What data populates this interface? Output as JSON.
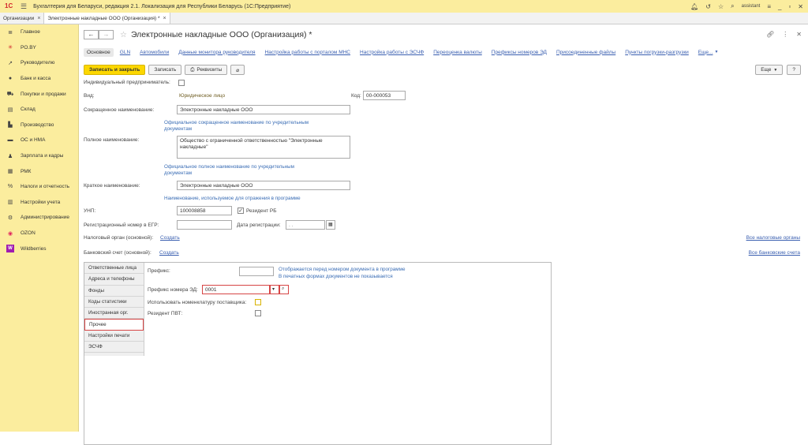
{
  "app": {
    "title": "Бухгалтерия для Беларуси, редакция 2.1. Локализация для Республики Беларусь (1С:Предприятие)",
    "logo": "1С",
    "user": "assistant"
  },
  "window_tabs": [
    {
      "label": "Организации"
    },
    {
      "label": "Электронные накладные ООО (Организация) *"
    }
  ],
  "sidebar": {
    "items": [
      {
        "label": "Главное",
        "icon": "menu-icon"
      },
      {
        "label": "PO.BY",
        "icon": "snowflake-icon"
      },
      {
        "label": "Руководителю",
        "icon": "chart-icon"
      },
      {
        "label": "Банк и касса",
        "icon": "coin-icon"
      },
      {
        "label": "Покупки и продажи",
        "icon": "cart-icon"
      },
      {
        "label": "Склад",
        "icon": "box-icon"
      },
      {
        "label": "Производство",
        "icon": "factory-icon"
      },
      {
        "label": "ОС и НМА",
        "icon": "truck-icon"
      },
      {
        "label": "Зарплата и кадры",
        "icon": "person-icon"
      },
      {
        "label": "РМК",
        "icon": "register-icon"
      },
      {
        "label": "Налоги и отчетность",
        "icon": "percent-icon"
      },
      {
        "label": "Настройки учета",
        "icon": "book-icon"
      },
      {
        "label": "Администрирование",
        "icon": "gear-icon"
      },
      {
        "label": "OZON",
        "icon": "ozon-icon"
      },
      {
        "label": "Wildberries",
        "icon": "wildberries-icon"
      }
    ]
  },
  "form": {
    "title": "Электронные накладные ООО (Организация) *",
    "links": [
      "Основное",
      "GLN",
      "Автомобили",
      "Данные монитора руководителя",
      "Настройка работы с порталом МНС",
      "Настройка работы с ЭСЧФ",
      "Переоценка валюты",
      "Префиксы номеров ЭД",
      "Присоединенные файлы",
      "Пункты погрузки-разгрузки",
      "Еще..."
    ],
    "toolbar": {
      "save_close": "Записать и закрыть",
      "save": "Записать",
      "requisites": "Реквизиты",
      "more": "Еще",
      "help": "?"
    },
    "individual_label": "Индивидуальный предприниматель:",
    "kind_label": "Вид:",
    "kind_value": "Юридическое лицо",
    "code_label": "Код:",
    "code_value": "00-000053",
    "short_name_label": "Сокращенное наименование:",
    "short_name_value": "Электронные накладные ООО",
    "short_name_hint": "Официальное сокращенное наименование по учредительным документам",
    "full_name_label": "Полное наименование:",
    "full_name_value": "Общество с ограниченной ответственностью \"Электронные накладные\"",
    "full_name_hint": "Официальное полное наименование по учредительным документам",
    "brief_name_label": "Краткое наименование:",
    "brief_name_value": "Электронные накладные ООО",
    "brief_name_hint": "Наименование, используемое для отражения в программе",
    "unp_label": "УНП:",
    "unp_value": "100008858",
    "resident_label": "Резидент РБ",
    "egr_label": "Регистрационный номер в ЕГР:",
    "reg_date_label": "Дата регистрации:",
    "reg_date_value": " .  .",
    "tax_label": "Налоговый орган (основной):",
    "tax_link": "Создать",
    "all_tax_link": "Все налоговые органы",
    "bank_label": "Банковский счет (основной):",
    "bank_link": "Создать",
    "all_bank_link": "Все банковские счета"
  },
  "panel": {
    "tabs": [
      "Ответственные лица",
      "Адреса и телефоны",
      "Фонды",
      "Коды статистики",
      "Иностранная орг.",
      "Прочее",
      "Настройки печати",
      "ЭСЧФ"
    ],
    "prefix_label": "Префикс:",
    "prefix_hint1": "Отображается перед номером документа в программе",
    "prefix_hint2": "В печатных формах документов не показывается",
    "ed_prefix_label": "Префикс номера ЭД:",
    "ed_prefix_value": "0001",
    "nomenclature_label": "Использовать номенклатуру поставщика:",
    "pvt_label": "Резидент ПВТ:"
  }
}
